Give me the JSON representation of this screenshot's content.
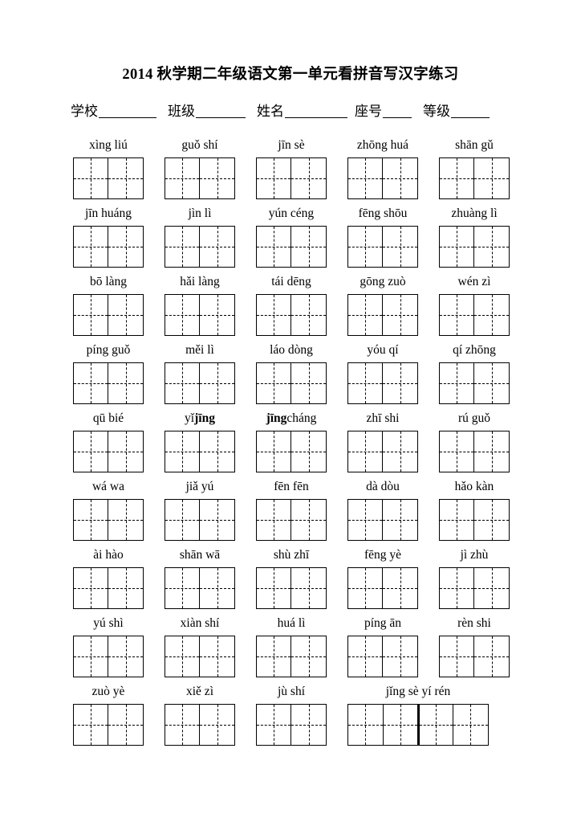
{
  "document": {
    "title": "2014 秋学期二年级语文第一单元看拼音写汉字练习"
  },
  "header": {
    "fields": [
      {
        "label": "学校",
        "value": "",
        "blank_width": 72
      },
      {
        "label": "班级",
        "value": "",
        "blank_width": 62
      },
      {
        "label": "姓名",
        "value": "",
        "blank_width": 78
      },
      {
        "label": "座号",
        "value": "",
        "blank_width": 36
      },
      {
        "label": "等级",
        "value": "",
        "blank_width": 48
      }
    ]
  },
  "worksheet": {
    "rows": [
      {
        "groups": [
          {
            "pinyin": "xìng   liú",
            "cells": 2
          },
          {
            "pinyin": "guǒ  shí",
            "cells": 2
          },
          {
            "pinyin": "jīn  sè",
            "cells": 2
          },
          {
            "pinyin": "zhōng huá",
            "cells": 2
          },
          {
            "pinyin": "shān gǔ",
            "cells": 2
          }
        ]
      },
      {
        "groups": [
          {
            "pinyin": "jīn  huáng",
            "cells": 2
          },
          {
            "pinyin": "jìn   lì",
            "cells": 2
          },
          {
            "pinyin": "yún céng",
            "cells": 2
          },
          {
            "pinyin": "fēng shōu",
            "cells": 2
          },
          {
            "pinyin": "zhuàng lì",
            "cells": 2
          }
        ]
      },
      {
        "groups": [
          {
            "pinyin": "bō   làng",
            "cells": 2
          },
          {
            "pinyin": "hǎi làng",
            "cells": 2
          },
          {
            "pinyin": "tái  dēng",
            "cells": 2
          },
          {
            "pinyin": "gōng  zuò",
            "cells": 2
          },
          {
            "pinyin": "wén  zì",
            "cells": 2
          }
        ]
      },
      {
        "groups": [
          {
            "pinyin": "píng guǒ",
            "cells": 2
          },
          {
            "pinyin": "měi   lì",
            "cells": 2
          },
          {
            "pinyin": "láo  dòng",
            "cells": 2
          },
          {
            "pinyin": "yóu  qí",
            "cells": 2
          },
          {
            "pinyin": "qí zhōng",
            "cells": 2
          }
        ]
      },
      {
        "groups": [
          {
            "pinyin": "qū   bié",
            "cells": 2
          },
          {
            "pinyin": "yǐ  jīng",
            "cells": 2,
            "bold_tail": "jīng",
            "bold_head": "yǐ  "
          },
          {
            "pinyin": "jīng cháng",
            "cells": 2,
            "bold_head": "jīng",
            "bold_tail": " cháng"
          },
          {
            "pinyin": "zhī shi",
            "cells": 2
          },
          {
            "pinyin": "rú   guǒ",
            "cells": 2
          }
        ]
      },
      {
        "groups": [
          {
            "pinyin": "wá   wa",
            "cells": 2
          },
          {
            "pinyin": "jiǎ   yú",
            "cells": 2
          },
          {
            "pinyin": "fēn  fēn",
            "cells": 2
          },
          {
            "pinyin": "dà  dòu",
            "cells": 2
          },
          {
            "pinyin": "hǎo  kàn",
            "cells": 2
          }
        ]
      },
      {
        "groups": [
          {
            "pinyin": "ài   hào",
            "cells": 2
          },
          {
            "pinyin": "shān  wā",
            "cells": 2
          },
          {
            "pinyin": "shù  zhī",
            "cells": 2
          },
          {
            "pinyin": "fēng  yè",
            "cells": 2
          },
          {
            "pinyin": "jì  zhù",
            "cells": 2
          }
        ]
      },
      {
        "groups": [
          {
            "pinyin": "yú   shì",
            "cells": 2
          },
          {
            "pinyin": "xiàn  shí",
            "cells": 2
          },
          {
            "pinyin": "huá   lì",
            "cells": 2
          },
          {
            "pinyin": "píng  ān",
            "cells": 2
          },
          {
            "pinyin": "rèn  shi",
            "cells": 2
          }
        ]
      },
      {
        "groups": [
          {
            "pinyin": "zuò   yè",
            "cells": 2
          },
          {
            "pinyin": "xiě  zì",
            "cells": 2
          },
          {
            "pinyin": "jù   shí",
            "cells": 2
          },
          {
            "pinyin": "jǐng  sè   yí   rén",
            "cells": 4,
            "divider_after": 2
          }
        ]
      }
    ]
  }
}
